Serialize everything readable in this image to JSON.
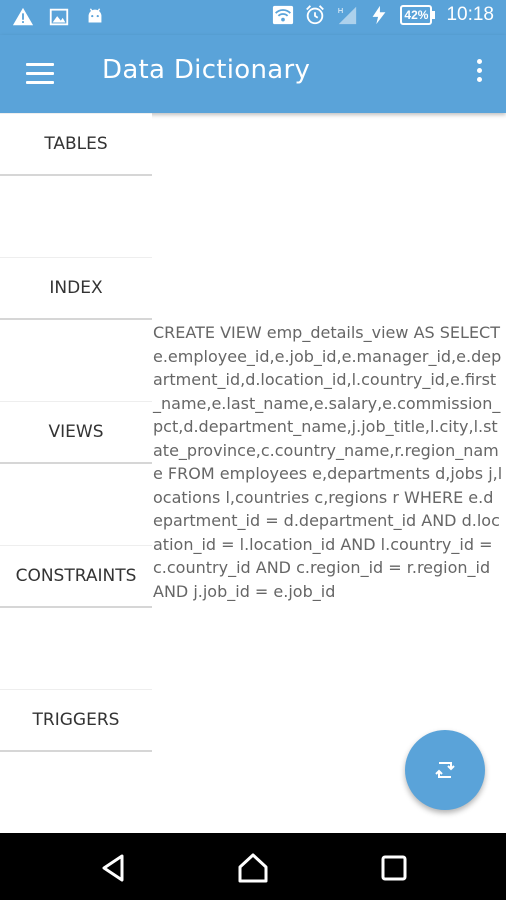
{
  "status_bar": {
    "time": "10:18",
    "battery": "42%",
    "icons": [
      "warning-icon",
      "image-icon",
      "android-icon",
      "wifi-icon",
      "alarm-icon",
      "signal-icon",
      "charging-icon",
      "battery-icon"
    ]
  },
  "app_bar": {
    "title": "Data Dictionary",
    "menu_icon": "hamburger-menu-icon",
    "overflow_icon": "more-vert-icon"
  },
  "nav": {
    "items": [
      {
        "label": "TABLES"
      },
      {
        "label": "INDEX"
      },
      {
        "label": "VIEWS"
      },
      {
        "label": "CONSTRAINTS"
      },
      {
        "label": "TRIGGERS"
      }
    ]
  },
  "content": {
    "sql": "CREATE VIEW emp_details_view AS SELECT e.employee_id,e.job_id,e.manager_id,e.department_id,d.location_id,l.country_id,e.first_name,e.last_name,e.salary,e.commission_pct,d.department_name,j.job_title,l.city,l.state_province,c.country_name,r.region_name FROM employees e,departments d,jobs j,locations l,countries c,regions r WHERE e.department_id = d.department_id AND d.location_id = l.location_id AND l.country_id = c.country_id AND c.region_id = r.region_id AND j.job_id = e.job_id"
  },
  "fab": {
    "icon": "swap-icon"
  },
  "system_nav": {
    "icons": [
      "back-icon",
      "home-icon",
      "recents-icon"
    ]
  },
  "colors": {
    "primary": "#5aa3d9",
    "text": "#666666"
  }
}
